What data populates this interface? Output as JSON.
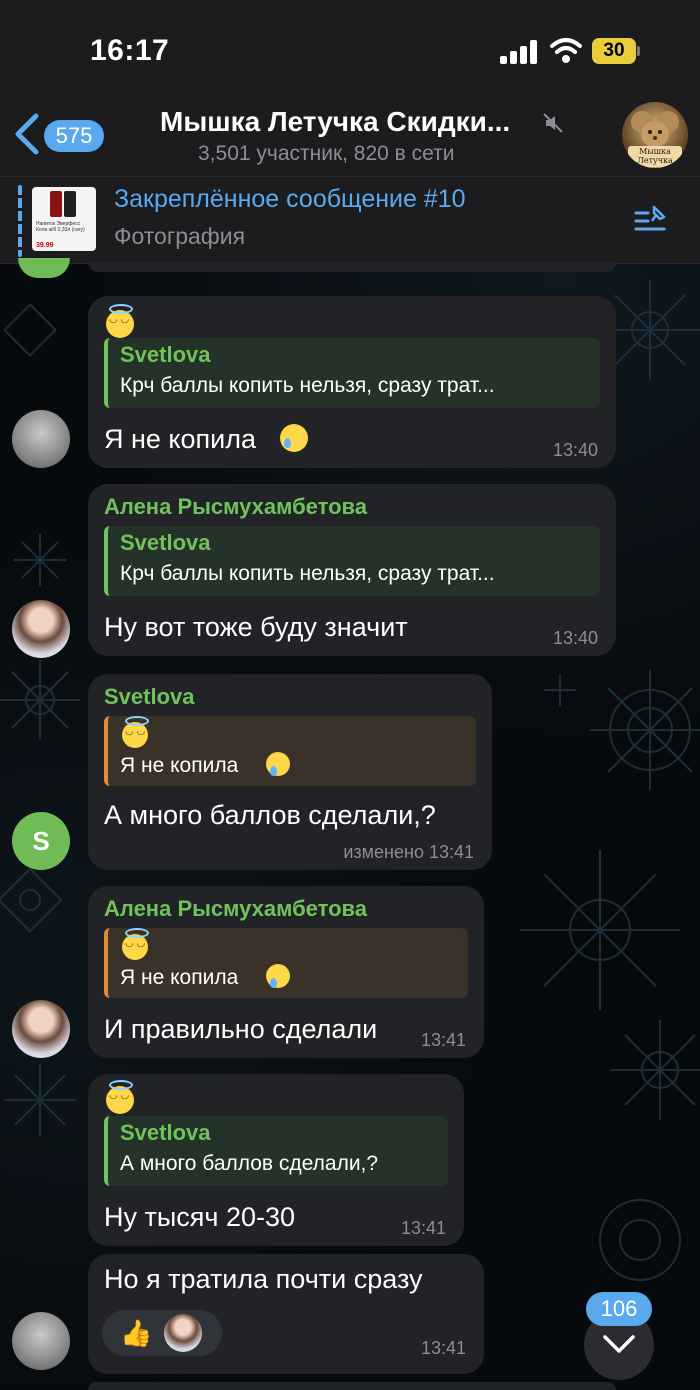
{
  "status_bar": {
    "time": "16:17",
    "battery": "30"
  },
  "header": {
    "back_count": "575",
    "title": "Мышка Летучка Скидки...",
    "subtitle": "3,501 участник, 820 в сети",
    "avatar_text": "Мышка Летучка Скидки"
  },
  "pinned": {
    "title": "Закреплённое сообщение #10",
    "subtitle": "Фотография",
    "thumb_text": "Напиток Эверфесс Кола ж/б 0,33л (сагу)",
    "thumb_price": "39.99"
  },
  "messages": [
    {
      "reply_name": "Svetlova",
      "reply_text": "Крч баллы копить нельзя, сразу трат...",
      "text": "Я не копила",
      "time": "13:40"
    },
    {
      "sender": "Алена Рысмухамбетова",
      "reply_name": "Svetlova",
      "reply_text": "Крч баллы копить нельзя, сразу трат...",
      "text": "Ну вот тоже буду значит",
      "time": "13:40"
    },
    {
      "sender": "Svetlova",
      "reply_text": "Я не копила",
      "text": "А много баллов сделали,?",
      "time": "изменено 13:41",
      "avatar_letter": "S"
    },
    {
      "sender": "Алена Рысмухамбетова",
      "reply_text": "Я не копила",
      "text": "И правильно сделали",
      "time": "13:41"
    },
    {
      "reply_name": "Svetlova",
      "reply_text": "А много баллов сделали,?",
      "text": "Ну тысяч 20-30",
      "time": "13:41"
    },
    {
      "text": "Но я тратила почти сразу",
      "time": "13:41",
      "reaction": "👍"
    }
  ],
  "scroll": {
    "unread_count": "106"
  },
  "colors": {
    "accent": "#5aa9ee",
    "sender_green": "#6fc35a",
    "reply_orange": "#e58a38",
    "bubble": "#212327"
  }
}
